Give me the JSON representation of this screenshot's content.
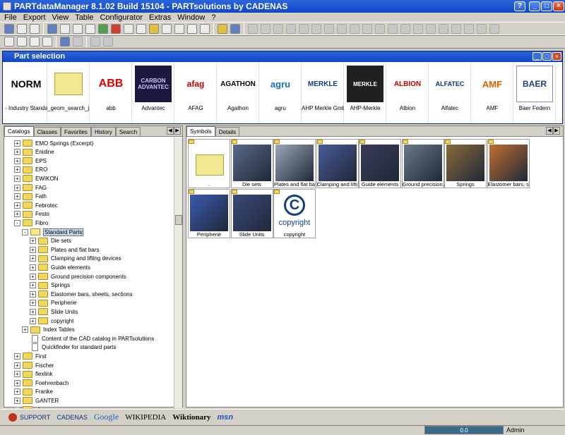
{
  "window": {
    "title": "PARTdataManager 8.1.02 Build 15104 - PARTsolutions by CADENAS",
    "minimize": "_",
    "maximize": "□",
    "close": "×"
  },
  "menu": [
    "File",
    "Export",
    "View",
    "Table",
    "Configurator",
    "Extras",
    "Window",
    "?"
  ],
  "part_window": {
    "title": "Part selection",
    "logos": [
      {
        "text": "NORM",
        "caption": "- Industry Standa..."
      },
      {
        "text": "",
        "caption": "_geom_search_j..."
      },
      {
        "text": "ABB",
        "caption": "abb"
      },
      {
        "text": "CARBON ADVANTEC",
        "caption": "Advantec"
      },
      {
        "text": "afag",
        "caption": "AFAG"
      },
      {
        "text": "AGATHON",
        "caption": "Agathon"
      },
      {
        "text": "agru",
        "caption": "agru"
      },
      {
        "text": "MERKLE",
        "caption": "AHP Merkle Gmb..."
      },
      {
        "text": "MERKLE",
        "caption": "AHP-Merkle"
      },
      {
        "text": "ALBION",
        "caption": "Albion"
      },
      {
        "text": "ALFATEC",
        "caption": "Alfatec"
      },
      {
        "text": "AMF",
        "caption": "AMF"
      },
      {
        "text": "BAER",
        "caption": "Baer Federn"
      }
    ]
  },
  "left_tabs": [
    "Catalogs",
    "Classes",
    "Favorites",
    "History",
    "Search"
  ],
  "right_tabs": [
    "Symbols",
    "Details"
  ],
  "tree": [
    {
      "label": "EMO Springs (Excerpt)",
      "level": 0,
      "type": "folder",
      "pm": "+"
    },
    {
      "label": "Enidine",
      "level": 0,
      "type": "folder",
      "pm": "+"
    },
    {
      "label": "EPS",
      "level": 0,
      "type": "folder",
      "pm": "+"
    },
    {
      "label": "ERO",
      "level": 0,
      "type": "folder",
      "pm": "+"
    },
    {
      "label": "EWIKON",
      "level": 0,
      "type": "folder",
      "pm": "+"
    },
    {
      "label": "FAG",
      "level": 0,
      "type": "folder",
      "pm": "+"
    },
    {
      "label": "Fath",
      "level": 0,
      "type": "folder",
      "pm": "+"
    },
    {
      "label": "Febrotec",
      "level": 0,
      "type": "folder",
      "pm": "+"
    },
    {
      "label": "Festo",
      "level": 0,
      "type": "folder",
      "pm": "+"
    },
    {
      "label": "Fibro",
      "level": 0,
      "type": "folder",
      "pm": "-"
    },
    {
      "label": "Standard Parts",
      "level": 1,
      "type": "folder-open",
      "pm": "-",
      "selected": true
    },
    {
      "label": "Die sets",
      "level": 2,
      "type": "folder",
      "pm": "+"
    },
    {
      "label": "Plates and flat bars",
      "level": 2,
      "type": "folder",
      "pm": "+"
    },
    {
      "label": "Clamping and lifting devices",
      "level": 2,
      "type": "folder",
      "pm": "+"
    },
    {
      "label": "Guide elements",
      "level": 2,
      "type": "folder",
      "pm": "+"
    },
    {
      "label": "Ground precision components",
      "level": 2,
      "type": "folder",
      "pm": "+"
    },
    {
      "label": "Springs",
      "level": 2,
      "type": "folder",
      "pm": "+"
    },
    {
      "label": "Elastomer bars, sheets, sections",
      "level": 2,
      "type": "folder",
      "pm": "+"
    },
    {
      "label": "Peripherie",
      "level": 2,
      "type": "folder",
      "pm": "+"
    },
    {
      "label": "Slide Units",
      "level": 2,
      "type": "folder",
      "pm": "+"
    },
    {
      "label": "copyright",
      "level": 2,
      "type": "folder",
      "pm": "+"
    },
    {
      "label": "Index Tables",
      "level": 1,
      "type": "folder",
      "pm": "+"
    },
    {
      "label": "Content of the CAD catalog in PARTsolutions",
      "level": 1,
      "type": "doc",
      "pm": ""
    },
    {
      "label": "Quickfinder for standard parts",
      "level": 1,
      "type": "doc",
      "pm": ""
    },
    {
      "label": "First",
      "level": 0,
      "type": "folder",
      "pm": "+"
    },
    {
      "label": "Fischer",
      "level": 0,
      "type": "folder",
      "pm": "+"
    },
    {
      "label": "flexlink",
      "level": 0,
      "type": "folder",
      "pm": "+"
    },
    {
      "label": "Foehrenbach",
      "level": 0,
      "type": "folder",
      "pm": "+"
    },
    {
      "label": "Franke",
      "level": 0,
      "type": "folder",
      "pm": "+"
    },
    {
      "label": "GANTER",
      "level": 0,
      "type": "folder",
      "pm": "+"
    },
    {
      "label": "gb",
      "level": 0,
      "type": "folder",
      "pm": "+"
    }
  ],
  "symbols": [
    {
      "label": "..",
      "kind": "up"
    },
    {
      "label": "Die sets",
      "kind": "img1"
    },
    {
      "label": "Plates and flat ba...",
      "kind": "img2"
    },
    {
      "label": "Clamping and lifti...",
      "kind": "img3"
    },
    {
      "label": "Guide elements",
      "kind": "img4"
    },
    {
      "label": "Ground precision...",
      "kind": "img5"
    },
    {
      "label": "Springs",
      "kind": "img6"
    },
    {
      "label": "Elastomer bars, s...",
      "kind": "img7"
    },
    {
      "label": "Peripherie",
      "kind": "img8"
    },
    {
      "label": "Slide Units",
      "kind": "img9"
    },
    {
      "label": "copyright",
      "kind": "copyright",
      "text": "copyright"
    }
  ],
  "bottom_links": [
    "SUPPORT",
    "CADENAS",
    "Google",
    "WIKIPEDIA",
    "Wiktionary",
    "msn"
  ],
  "status": {
    "progress": "0.0",
    "user": "Admin"
  },
  "icons": {
    "folder": "folder-icon",
    "doc": "document-icon"
  }
}
